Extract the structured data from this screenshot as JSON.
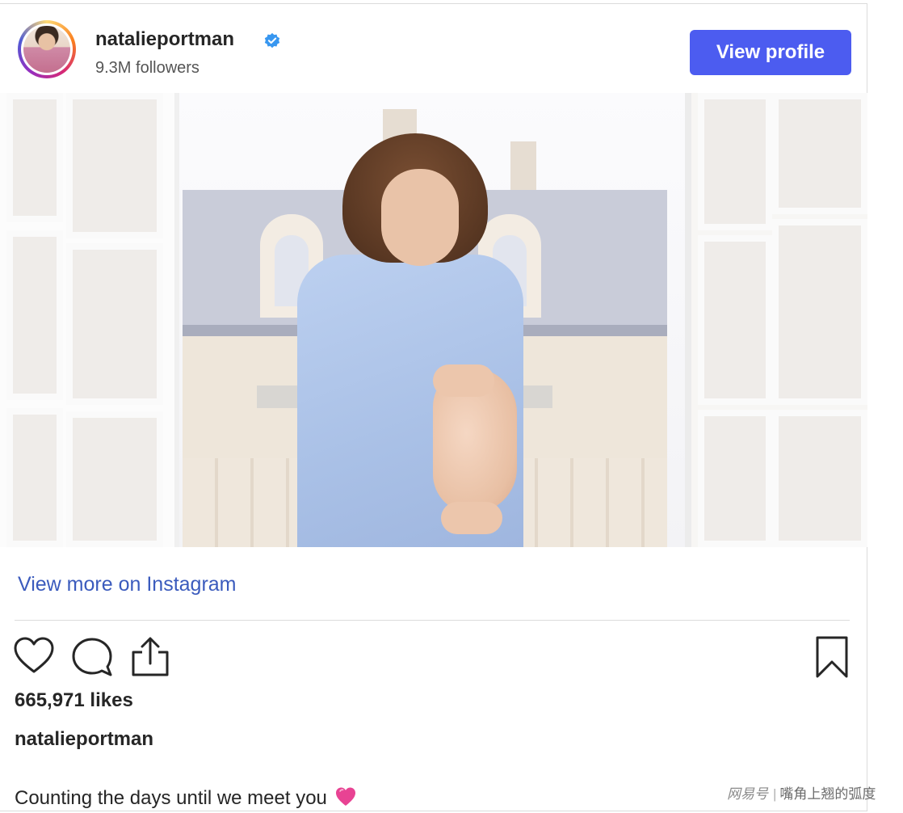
{
  "post": {
    "username": "natalieportman",
    "followers": "9.3M followers",
    "view_profile_label": "View profile",
    "verified": true
  },
  "links": {
    "view_more": "View more on Instagram"
  },
  "actions": {
    "icons": [
      "heart-icon",
      "comment-icon",
      "share-icon",
      "bookmark-icon"
    ]
  },
  "stats": {
    "likes": "665,971 likes"
  },
  "caption": {
    "username": "natalieportman",
    "text": "Counting the days until we meet you",
    "emoji": "pink-heart"
  },
  "watermark": {
    "brand": "网易号",
    "author": "嘴角上翘的弧度"
  },
  "colors": {
    "button": "#4c5cf0",
    "link": "#3b5bbd",
    "verified": "#3897f0",
    "heart_emoji": "#e84393"
  }
}
